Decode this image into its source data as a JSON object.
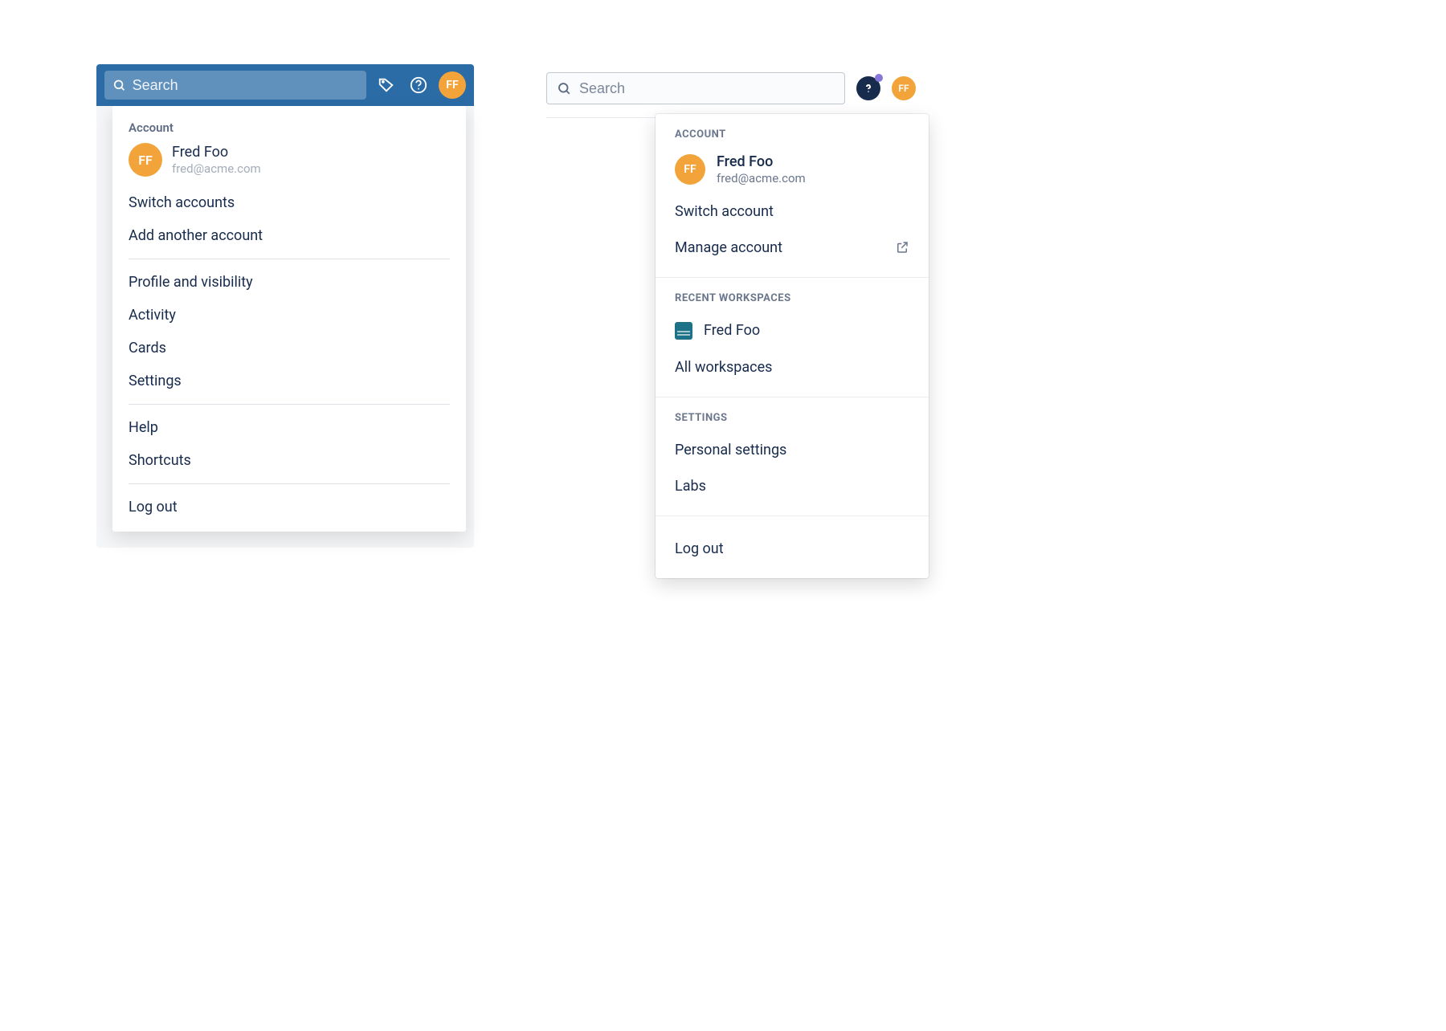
{
  "left": {
    "search_placeholder": "Search",
    "avatar_initials": "FF",
    "section_account": "Account",
    "user_name": "Fred Foo",
    "user_email": "fred@acme.com",
    "items_account": {
      "switch_accounts": "Switch accounts",
      "add_another": "Add another account"
    },
    "items_profile": {
      "profile_visibility": "Profile and visibility",
      "activity": "Activity",
      "cards": "Cards",
      "settings": "Settings"
    },
    "items_help": {
      "help": "Help",
      "shortcuts": "Shortcuts"
    },
    "logout": "Log out"
  },
  "right": {
    "search_placeholder": "Search",
    "avatar_initials": "FF",
    "section_account": "Account",
    "user_name": "Fred Foo",
    "user_email": "fred@acme.com",
    "switch_account": "Switch account",
    "manage_account": "Manage account",
    "section_recent": "Recent Workspaces",
    "workspace_name": "Fred Foo",
    "all_workspaces": "All workspaces",
    "section_settings": "Settings",
    "personal_settings": "Personal settings",
    "labs": "Labs",
    "logout": "Log out"
  }
}
